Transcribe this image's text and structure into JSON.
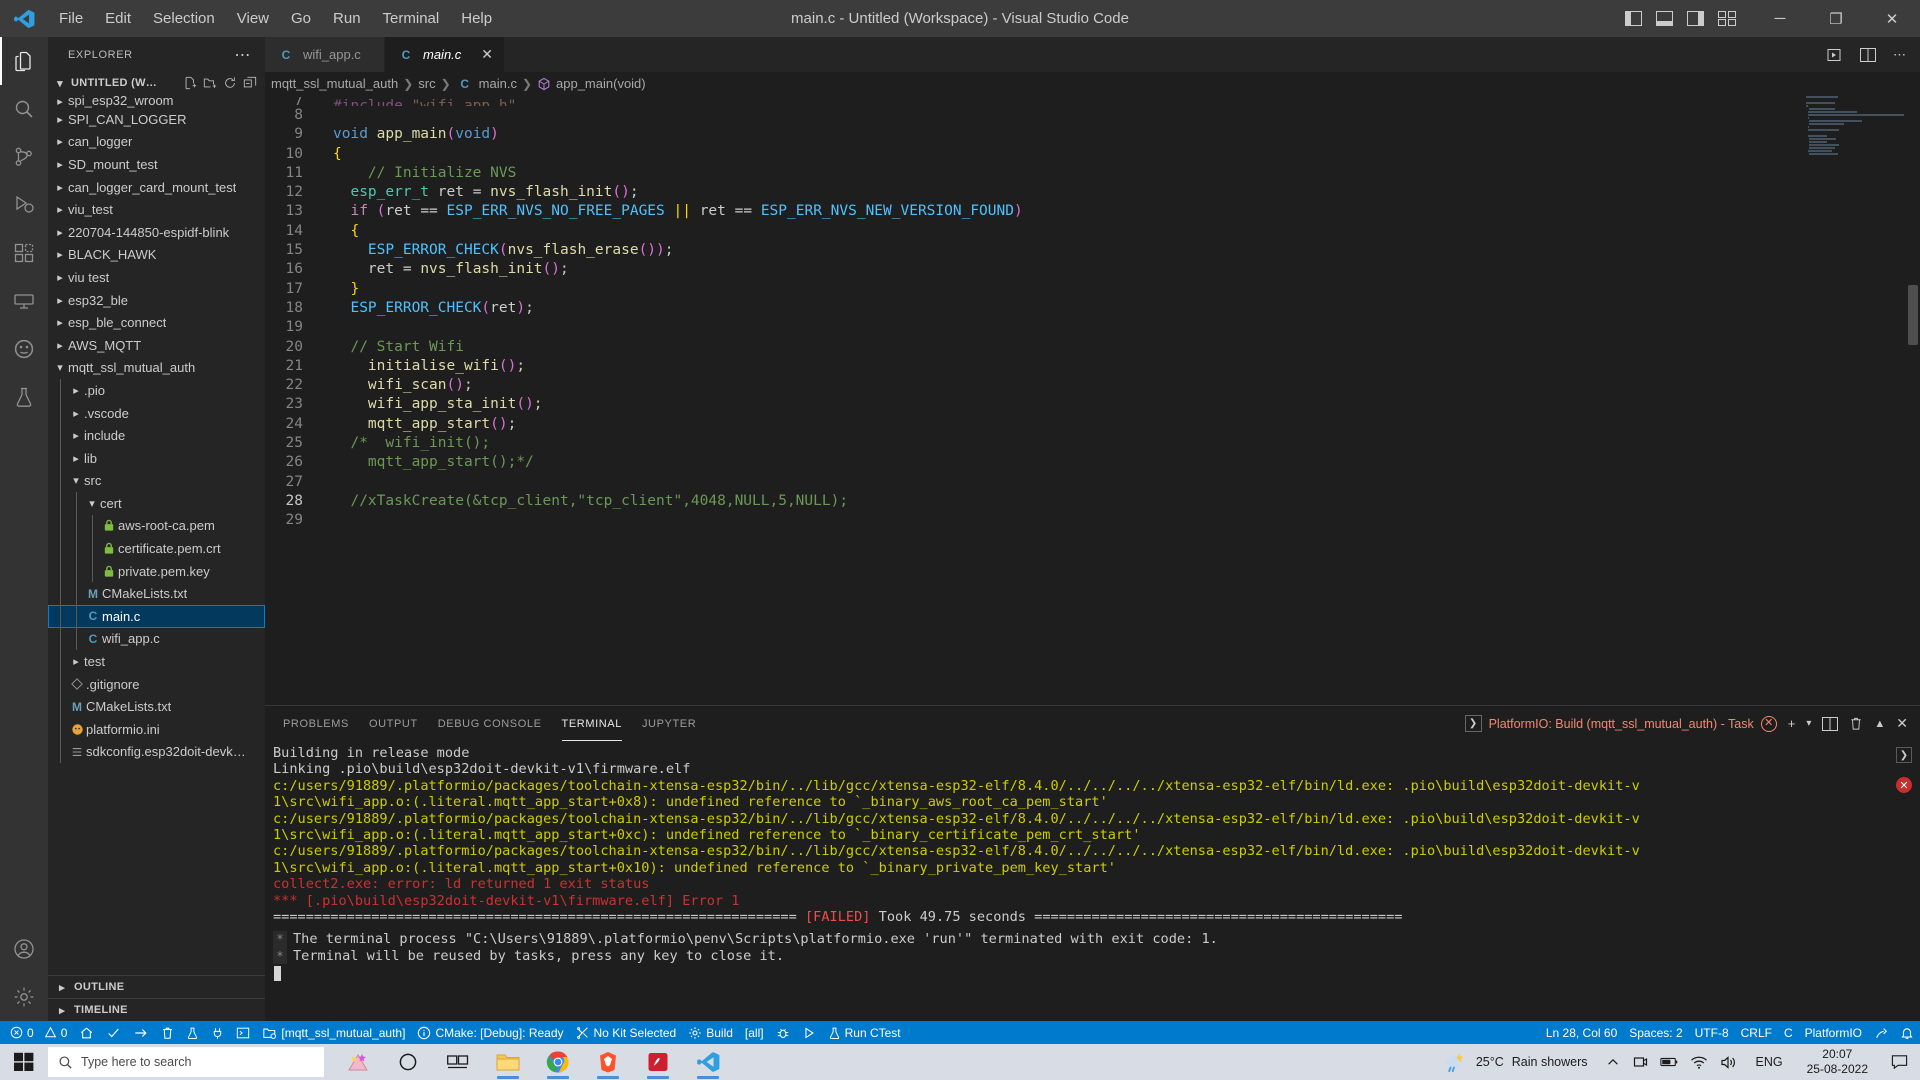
{
  "titlebar": {
    "title": "main.c - Untitled (Workspace) - Visual Studio Code",
    "menus": [
      "File",
      "Edit",
      "Selection",
      "View",
      "Go",
      "Run",
      "Terminal",
      "Help"
    ],
    "window_controls": {
      "minimize": "─",
      "maximize": "❐",
      "close": "✕"
    }
  },
  "activitybar": {
    "items": [
      {
        "name": "explorer",
        "icon": "files-icon"
      },
      {
        "name": "search",
        "icon": "search-icon"
      },
      {
        "name": "source-control",
        "icon": "source-control-icon"
      },
      {
        "name": "run-and-debug",
        "icon": "run-debug-icon"
      },
      {
        "name": "extensions",
        "icon": "extensions-icon"
      },
      {
        "name": "remote-explorer",
        "icon": "remote-explorer-icon"
      },
      {
        "name": "platformio",
        "icon": "platformio-icon"
      },
      {
        "name": "testing",
        "icon": "testing-icon"
      }
    ],
    "bottom": [
      {
        "name": "accounts",
        "icon": "account-icon"
      },
      {
        "name": "settings",
        "icon": "gear-icon"
      }
    ]
  },
  "sidebar": {
    "header": "EXPLORER",
    "more_actions": "⋯",
    "workspace": "UNTITLED (W…",
    "workspace_actions": [
      "new-file-icon",
      "new-folder-icon",
      "refresh-icon",
      "collapse-all-icon"
    ],
    "tree": [
      {
        "label": "spi_esp32_wroom",
        "type": "folder",
        "state": "collapsed",
        "depth": 0,
        "clipped": true
      },
      {
        "label": "SPI_CAN_LOGGER",
        "type": "folder",
        "state": "collapsed",
        "depth": 0
      },
      {
        "label": "can_logger",
        "type": "folder",
        "state": "collapsed",
        "depth": 0
      },
      {
        "label": "SD_mount_test",
        "type": "folder",
        "state": "collapsed",
        "depth": 0
      },
      {
        "label": "can_logger_card_mount_test",
        "type": "folder",
        "state": "collapsed",
        "depth": 0
      },
      {
        "label": "viu_test",
        "type": "folder",
        "state": "collapsed",
        "depth": 0
      },
      {
        "label": "220704-144850-espidf-blink",
        "type": "folder",
        "state": "collapsed",
        "depth": 0
      },
      {
        "label": "BLACK_HAWK",
        "type": "folder",
        "state": "collapsed",
        "depth": 0
      },
      {
        "label": "viu test",
        "type": "folder",
        "state": "collapsed",
        "depth": 0
      },
      {
        "label": "esp32_ble",
        "type": "folder",
        "state": "collapsed",
        "depth": 0
      },
      {
        "label": "esp_ble_connect",
        "type": "folder",
        "state": "collapsed",
        "depth": 0
      },
      {
        "label": "AWS_MQTT",
        "type": "folder",
        "state": "collapsed",
        "depth": 0
      },
      {
        "label": "mqtt_ssl_mutual_auth",
        "type": "folder",
        "state": "expanded",
        "depth": 0
      },
      {
        "label": ".pio",
        "type": "folder",
        "state": "collapsed",
        "depth": 1
      },
      {
        "label": ".vscode",
        "type": "folder",
        "state": "collapsed",
        "depth": 1
      },
      {
        "label": "include",
        "type": "folder",
        "state": "collapsed",
        "depth": 1
      },
      {
        "label": "lib",
        "type": "folder",
        "state": "collapsed",
        "depth": 1
      },
      {
        "label": "src",
        "type": "folder",
        "state": "expanded",
        "depth": 1
      },
      {
        "label": "cert",
        "type": "folder",
        "state": "expanded",
        "depth": 2
      },
      {
        "label": "aws-root-ca.pem",
        "type": "file",
        "icon": "lock-icon",
        "depth": 3
      },
      {
        "label": "certificate.pem.crt",
        "type": "file",
        "icon": "lock-icon",
        "depth": 3
      },
      {
        "label": "private.pem.key",
        "type": "file",
        "icon": "lock-icon",
        "depth": 3
      },
      {
        "label": "CMakeLists.txt",
        "type": "file",
        "icon": "M",
        "depth": 2
      },
      {
        "label": "main.c",
        "type": "file",
        "icon": "C",
        "depth": 2,
        "selected": true
      },
      {
        "label": "wifi_app.c",
        "type": "file",
        "icon": "C",
        "depth": 2
      },
      {
        "label": "test",
        "type": "folder",
        "state": "collapsed",
        "depth": 1
      },
      {
        "label": ".gitignore",
        "type": "file",
        "icon": "git-icon",
        "depth": 1
      },
      {
        "label": "CMakeLists.txt",
        "type": "file",
        "icon": "M",
        "depth": 1
      },
      {
        "label": "platformio.ini",
        "type": "file",
        "icon": "platformio-icon",
        "depth": 1
      },
      {
        "label": "sdkconfig.esp32doit-devk…",
        "type": "file",
        "icon": "settings-icon",
        "depth": 1
      }
    ],
    "collapsed_sections": [
      "OUTLINE",
      "TIMELINE"
    ]
  },
  "editor": {
    "tabs": [
      {
        "label": "wifi_app.c",
        "icon": "C",
        "active": false
      },
      {
        "label": "main.c",
        "icon": "C",
        "active": true,
        "close": "✕"
      }
    ],
    "tab_actions": [
      "split-editor-icon",
      "more-actions-icon"
    ],
    "breadcrumb": [
      "mqtt_ssl_mutual_auth",
      "src",
      "main.c",
      "app_main(void)"
    ],
    "first_visible_line": 7,
    "lines": [
      {
        "n": 7,
        "text": "#include \"wifi_app.h\"",
        "clipped": true
      },
      {
        "n": 8,
        "text": ""
      },
      {
        "n": 9,
        "text": "void app_main(void)"
      },
      {
        "n": 10,
        "text": "{"
      },
      {
        "n": 11,
        "text": "    // Initialize NVS"
      },
      {
        "n": 12,
        "text": "  esp_err_t ret = nvs_flash_init();"
      },
      {
        "n": 13,
        "text": "  if (ret == ESP_ERR_NVS_NO_FREE_PAGES || ret == ESP_ERR_NVS_NEW_VERSION_FOUND)"
      },
      {
        "n": 14,
        "text": "  {"
      },
      {
        "n": 15,
        "text": "    ESP_ERROR_CHECK(nvs_flash_erase());"
      },
      {
        "n": 16,
        "text": "    ret = nvs_flash_init();"
      },
      {
        "n": 17,
        "text": "  }"
      },
      {
        "n": 18,
        "text": "  ESP_ERROR_CHECK(ret);"
      },
      {
        "n": 19,
        "text": ""
      },
      {
        "n": 20,
        "text": "  // Start Wifi"
      },
      {
        "n": 21,
        "text": "    initialise_wifi();"
      },
      {
        "n": 22,
        "text": "    wifi_scan();"
      },
      {
        "n": 23,
        "text": "    wifi_app_sta_init();"
      },
      {
        "n": 24,
        "text": "    mqtt_app_start();"
      },
      {
        "n": 25,
        "text": "  /*  wifi_init();"
      },
      {
        "n": 26,
        "text": "    mqtt_app_start();*/"
      },
      {
        "n": 27,
        "text": ""
      },
      {
        "n": 28,
        "text": "  //xTaskCreate(&tcp_client,\"tcp_client\",4048,NULL,5,NULL);",
        "current": true
      },
      {
        "n": 29,
        "text": ""
      }
    ]
  },
  "panel": {
    "tabs": [
      "PROBLEMS",
      "OUTPUT",
      "DEBUG CONSOLE",
      "TERMINAL",
      "JUPYTER"
    ],
    "active_tab": "TERMINAL",
    "terminal_label": "PlatformIO: Build (mqtt_ssl_mutual_auth) - Task",
    "actions": [
      "new-terminal-icon",
      "chevron-down-icon",
      "split-terminal-icon",
      "kill-terminal-icon",
      "maximize-panel-icon",
      "close-panel-icon"
    ],
    "output": [
      {
        "text": "Building in release mode",
        "color": "default"
      },
      {
        "text": "Linking .pio\\build\\esp32doit-devkit-v1\\firmware.elf",
        "color": "default"
      },
      {
        "text": "c:/users/91889/.platformio/packages/toolchain-xtensa-esp32/bin/../lib/gcc/xtensa-esp32-elf/8.4.0/../../../../xtensa-esp32-elf/bin/ld.exe: .pio\\build\\esp32doit-devkit-v",
        "color": "yellow"
      },
      {
        "text": "1\\src\\wifi_app.o:(.literal.mqtt_app_start+0x8): undefined reference to `_binary_aws_root_ca_pem_start'",
        "color": "yellow"
      },
      {
        "text": "c:/users/91889/.platformio/packages/toolchain-xtensa-esp32/bin/../lib/gcc/xtensa-esp32-elf/8.4.0/../../../../xtensa-esp32-elf/bin/ld.exe: .pio\\build\\esp32doit-devkit-v",
        "color": "yellow"
      },
      {
        "text": "1\\src\\wifi_app.o:(.literal.mqtt_app_start+0xc): undefined reference to `_binary_certificate_pem_crt_start'",
        "color": "yellow"
      },
      {
        "text": "c:/users/91889/.platformio/packages/toolchain-xtensa-esp32/bin/../lib/gcc/xtensa-esp32-elf/8.4.0/../../../../xtensa-esp32-elf/bin/ld.exe: .pio\\build\\esp32doit-devkit-v",
        "color": "yellow"
      },
      {
        "text": "1\\src\\wifi_app.o:(.literal.mqtt_app_start+0x10): undefined reference to `_binary_private_pem_key_start'",
        "color": "yellow"
      },
      {
        "text": "collect2.exe: error: ld returned 1 exit status",
        "color": "red"
      },
      {
        "text": "*** [.pio\\build\\esp32doit-devkit-v1\\firmware.elf] Error 1",
        "color": "red"
      }
    ],
    "summary": {
      "left_rule": "================================================================",
      "status": "[FAILED]",
      "took": "Took 49.75 seconds",
      "right_rule": "============================================="
    },
    "task_messages": [
      "The terminal process \"C:\\Users\\91889\\.platformio\\penv\\Scripts\\platformio.exe 'run'\" terminated with exit code: 1.",
      "Terminal will be reused by tasks, press any key to close it."
    ],
    "task_gutter_marks": [
      "*",
      "*"
    ]
  },
  "statusbar": {
    "left": [
      {
        "name": "remote-errors",
        "icon": "error-icon",
        "label": "0"
      },
      {
        "name": "remote-warnings",
        "icon": "warning-icon",
        "label": "0"
      },
      {
        "name": "platformio-home",
        "icon": "home-icon",
        "label": ""
      },
      {
        "name": "platformio-build",
        "icon": "check-icon",
        "label": ""
      },
      {
        "name": "platformio-upload",
        "icon": "arrow-right-icon",
        "label": ""
      },
      {
        "name": "platformio-clean",
        "icon": "trash-icon",
        "label": ""
      },
      {
        "name": "platformio-test",
        "icon": "flask-icon",
        "label": ""
      },
      {
        "name": "platformio-serial-monitor",
        "icon": "plug-icon",
        "label": ""
      },
      {
        "name": "platformio-terminal",
        "icon": "terminal-icon",
        "label": ""
      },
      {
        "name": "project-env",
        "icon": "folder-env-icon",
        "label": "[mqtt_ssl_mutual_auth]"
      },
      {
        "name": "cmake-status",
        "icon": "info-icon",
        "label": "CMake: [Debug]: Ready"
      },
      {
        "name": "cmake-kit",
        "icon": "tools-icon",
        "label": "No Kit Selected"
      },
      {
        "name": "cmake-build",
        "icon": "gear-icon",
        "label": "Build"
      },
      {
        "name": "cmake-target",
        "icon": "",
        "label": "[all]"
      },
      {
        "name": "cmake-debug",
        "icon": "bug-icon",
        "label": ""
      },
      {
        "name": "cmake-launch",
        "icon": "play-icon",
        "label": ""
      },
      {
        "name": "cmake-ctest",
        "icon": "flask-icon",
        "label": "Run CTest"
      }
    ],
    "right": [
      {
        "name": "cursor-position",
        "label": "Ln 28, Col 60"
      },
      {
        "name": "indentation",
        "label": "Spaces: 2"
      },
      {
        "name": "encoding",
        "label": "UTF-8"
      },
      {
        "name": "eol",
        "label": "CRLF"
      },
      {
        "name": "language-mode",
        "label": "C"
      },
      {
        "name": "platformio-status",
        "label": "PlatformIO"
      },
      {
        "name": "feedback",
        "icon": "feedback-icon",
        "label": ""
      },
      {
        "name": "notifications",
        "icon": "bell-icon",
        "label": ""
      }
    ]
  },
  "taskbar": {
    "search_placeholder": "Type here to search",
    "apps": [
      {
        "name": "taskview-icon",
        "label": ""
      },
      {
        "name": "cortana-icon",
        "label": ""
      },
      {
        "name": "file-explorer",
        "label": ""
      },
      {
        "name": "chrome",
        "label": ""
      },
      {
        "name": "brave",
        "label": ""
      },
      {
        "name": "adobe-reader",
        "label": ""
      },
      {
        "name": "vscode",
        "label": ""
      }
    ],
    "weather": {
      "temp": "25°C",
      "condition": "Rain showers"
    },
    "tray": {
      "lang": "ENG"
    },
    "clock": {
      "time": "20:07",
      "date": "25-08-2022"
    }
  }
}
